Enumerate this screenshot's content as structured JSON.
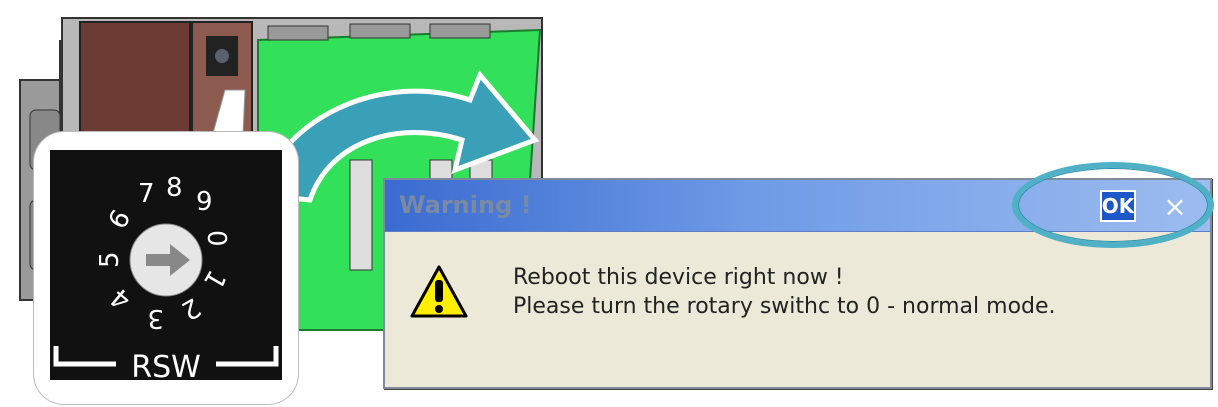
{
  "dialog": {
    "title": "Warning !",
    "ok_label": "OK",
    "close_glyph": "×",
    "message_line1": "Reboot this device right now !",
    "message_line2": "Please turn the rotary swithc to 0 - normal mode.",
    "icon": "warning-icon"
  },
  "rotary_switch": {
    "label": "RSW",
    "digits": [
      "0",
      "1",
      "2",
      "3",
      "4",
      "5",
      "6",
      "7",
      "8",
      "9"
    ]
  },
  "colors": {
    "highlight_ring": "#4fb0c6",
    "titlebar": "#3a6bd0",
    "board_green": "#33e05a",
    "arrow": "#3aa0b8"
  }
}
